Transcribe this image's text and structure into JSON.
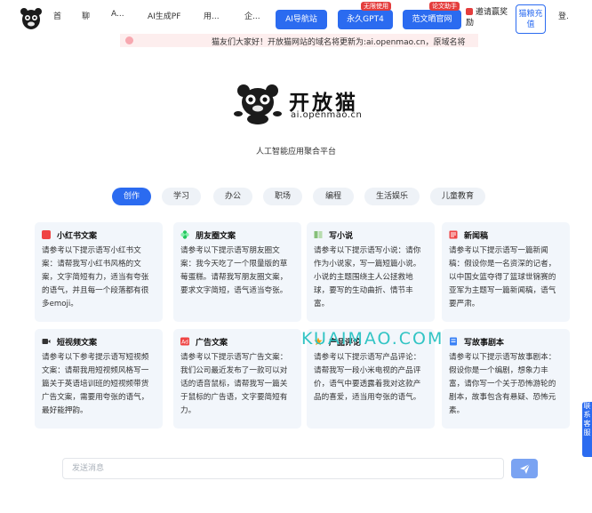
{
  "topbar": {
    "nav_items": [
      "首",
      "聊",
      "A...",
      "AI生成PF",
      "用...",
      "企..."
    ],
    "pills": [
      {
        "label": "AI导航站",
        "badge": ""
      },
      {
        "label": "永久GPT4",
        "badge": "无限使用"
      },
      {
        "label": "范文晒官网",
        "badge": "论文助手"
      }
    ],
    "invite_label": "邀请赢奖励",
    "recharge_label": "猫粮充值",
    "login_label": "登."
  },
  "notice": {
    "text": "猫友们大家好！开放猫网站的域名将更新为:ai.openmao.cn，原域名将"
  },
  "hero": {
    "brand_name": "开放猫",
    "domain": "ai.openmao.cn",
    "tagline": "人工智能应用聚合平台"
  },
  "tabs": [
    "创作",
    "学习",
    "办公",
    "职场",
    "编程",
    "生活娱乐",
    "儿童教育"
  ],
  "cards": [
    {
      "icon": "xiaohongshu-icon",
      "color": "#ef4444",
      "title": "小红书文案",
      "body": "请参考以下提示语写小红书文案：请帮我写小红书风格的文案，文字简短有力，适当有夸张的语气，并且每一个段落都有很多emoji。"
    },
    {
      "icon": "moments-icon",
      "color": "#22c55e",
      "title": "朋友圈文案",
      "body": "请参考以下提示语写朋友圈文案：我今天吃了一个限量版的草莓蛋糕。请帮我写朋友圈文案，要求文字简短，语气适当夸张。"
    },
    {
      "icon": "book-icon",
      "color": "#86c07a",
      "title": "写小说",
      "body": "请参考以下提示语写小说：请你作为小说家，写一篇短篇小说。小说的主题围绕主人公拯救地球，要写的生动曲折、情节丰富。"
    },
    {
      "icon": "news-icon",
      "color": "#ef4444",
      "title": "新闻稿",
      "body": "请参考以下提示语写一篇新闻稿：假设你是一名资深的记者，以中国女篮夺得了篮球世锦赛的亚军为主题写一篇新闻稿，语气要严肃。"
    },
    {
      "icon": "video-icon",
      "color": "#333333",
      "title": "短视频文案",
      "body": "请参考以下参考提示语写短视频文案：请帮我用短视频风格写一篇关于英语培训班的短视频带货广告文案，需要用夸张的语气，最好能押韵。"
    },
    {
      "icon": "ad-icon",
      "color": "#ef4444",
      "title": "广告文案",
      "body": "请参考以下提示语写广告文案：我们公司最近发布了一款可以对话的语音鼠标，请帮我写一篇关于鼠标的广告语，文字要简短有力。"
    },
    {
      "icon": "review-icon",
      "color": "#f59e0b",
      "title": "产品评论",
      "body": "请参考以下提示语写产品评论：请帮我写一段小米电视的产品评价，语气中要透露着我对这款产品的喜爱，适当用夸张的语气。"
    },
    {
      "icon": "script-icon",
      "color": "#3b82f6",
      "title": "写故事剧本",
      "body": "请参考以下提示语写故事剧本：假设你是一个编剧，想象力丰富，请你写一个关于恐怖游轮的剧本，故事包含有悬疑、恐怖元素。"
    }
  ],
  "watermark": "KUAIMAO.COM",
  "side_float": "联系客服",
  "composer": {
    "placeholder": "发送消息"
  },
  "colors": {
    "accent": "#2b6bf0",
    "card_bg": "#f2f6fb",
    "notice_bg": "#fdeeee"
  }
}
